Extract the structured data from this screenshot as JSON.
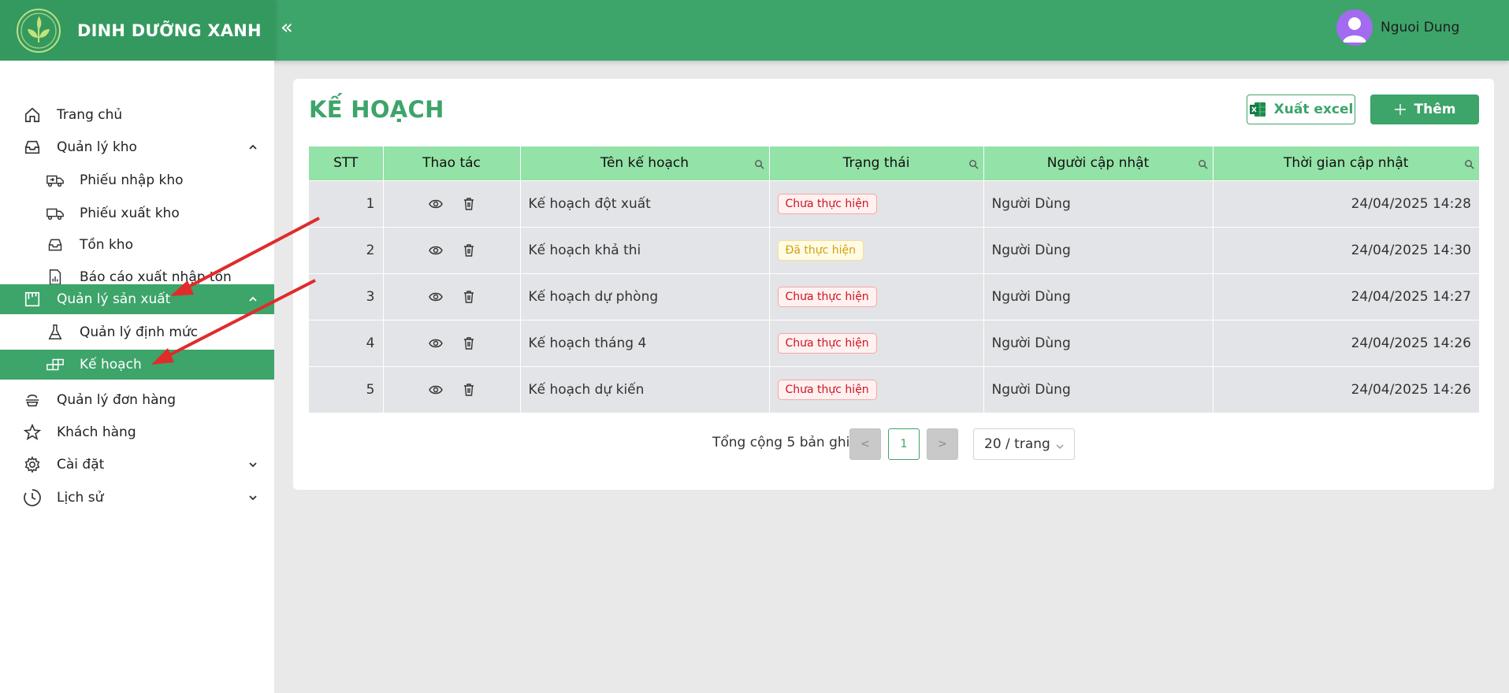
{
  "header": {
    "brand": "DINH DƯỠNG XANH",
    "user_name": "Nguoi Dung",
    "colors": {
      "primary": "#3da46a",
      "brand_bg": "#34995e",
      "avatar": "#a26bf0"
    }
  },
  "sidebar": {
    "items": [
      {
        "label": "Trang chủ",
        "icon": "home-icon"
      },
      {
        "label": "Quản lý kho",
        "icon": "inbox-icon",
        "expanded": true
      },
      {
        "label": "Phiếu nhập kho",
        "icon": "truck-in-icon"
      },
      {
        "label": "Phiếu xuất kho",
        "icon": "truck-out-icon"
      },
      {
        "label": "Tồn kho",
        "icon": "inbox-icon"
      },
      {
        "label": "Báo cáo xuất nhập tồn",
        "icon": "report-icon"
      },
      {
        "label": "Quản lý sản xuất",
        "icon": "factory-icon",
        "expanded": true,
        "active": true
      },
      {
        "label": "Quản lý định mức",
        "icon": "flask-icon"
      },
      {
        "label": "Kế hoạch",
        "icon": "blocks-icon",
        "active": true
      },
      {
        "label": "Quản lý đơn hàng",
        "icon": "order-icon"
      },
      {
        "label": "Khách hàng",
        "icon": "star-icon"
      },
      {
        "label": "Cài đặt",
        "icon": "gear-icon",
        "expanded": false
      },
      {
        "label": "Lịch sử",
        "icon": "clock-icon",
        "expanded": false
      }
    ]
  },
  "main": {
    "title": "KẾ HOẠCH",
    "export_label": "Xuất excel",
    "add_label": "Thêm",
    "table": {
      "columns": [
        "STT",
        "Thao tác",
        "Tên kế hoạch",
        "Trạng thái",
        "Người cập nhật",
        "Thời gian cập nhật"
      ],
      "rows": [
        {
          "stt": "1",
          "name": "Kế hoạch đột xuất",
          "status": "Chưa thực hiện",
          "status_type": "red",
          "updated_by": "Người Dùng",
          "updated_at": "24/04/2025 14:28"
        },
        {
          "stt": "2",
          "name": "Kế hoạch khả thi",
          "status": "Đã thực hiện",
          "status_type": "yellow",
          "updated_by": "Người Dùng",
          "updated_at": "24/04/2025 14:30"
        },
        {
          "stt": "3",
          "name": "Kế hoạch dự phòng",
          "status": "Chưa thực hiện",
          "status_type": "red",
          "updated_by": "Người Dùng",
          "updated_at": "24/04/2025 14:27"
        },
        {
          "stt": "4",
          "name": "Kế hoạch tháng 4",
          "status": "Chưa thực hiện",
          "status_type": "red",
          "updated_by": "Người Dùng",
          "updated_at": "24/04/2025 14:26"
        },
        {
          "stt": "5",
          "name": "Kế hoạch dự kiến",
          "status": "Chưa thực hiện",
          "status_type": "red",
          "updated_by": "Người Dùng",
          "updated_at": "24/04/2025 14:26"
        }
      ]
    },
    "pagination": {
      "total_text": "Tổng cộng 5 bản ghi",
      "current_page": "1",
      "page_size": "20 / trang"
    }
  },
  "annotations": {
    "arrow_color": "#e02b2b"
  }
}
